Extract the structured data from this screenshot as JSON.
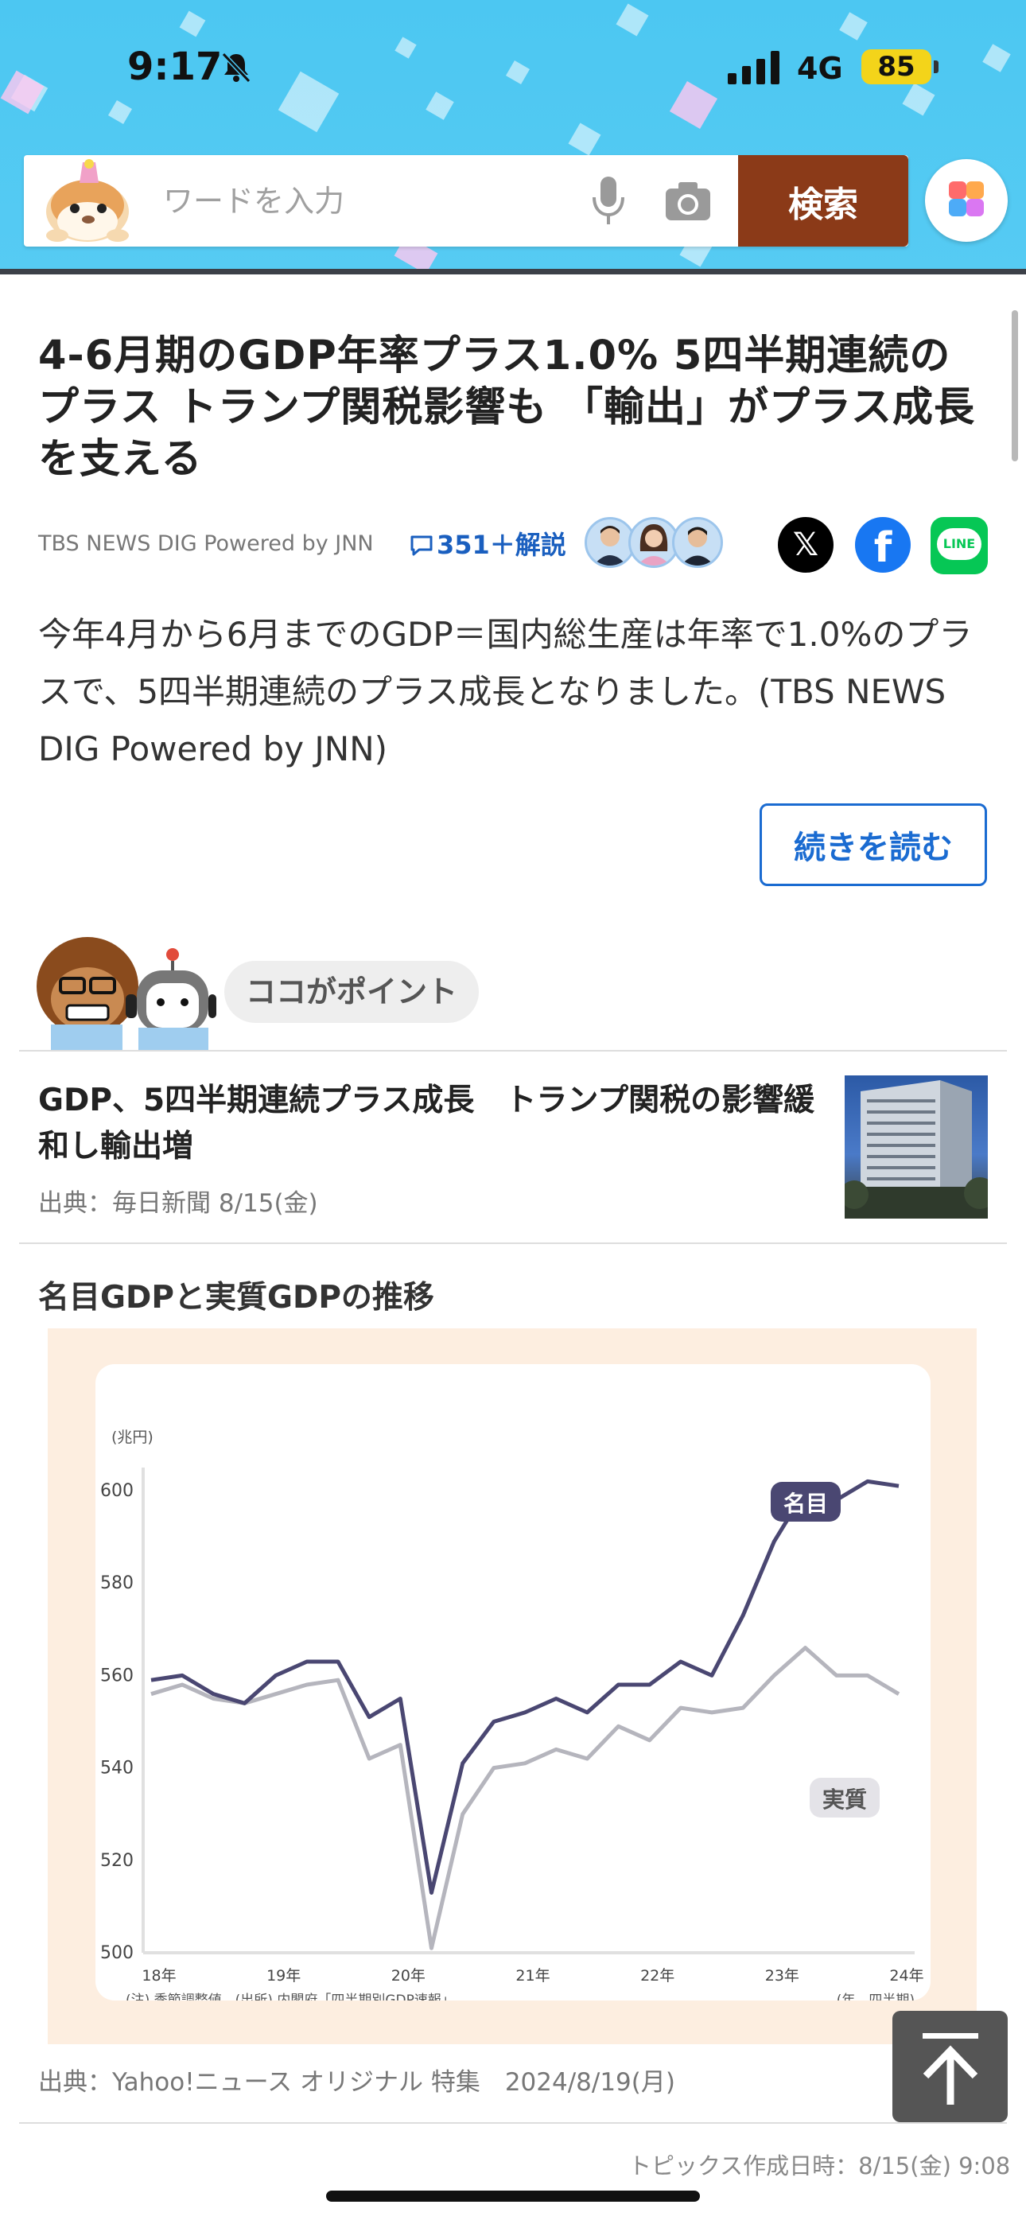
{
  "status_bar": {
    "time": "9:17",
    "network": "4G",
    "battery": "85"
  },
  "search": {
    "placeholder": "ワードを入力",
    "button_label": "検索"
  },
  "article": {
    "headline": "4-6月期のGDP年率プラス1.0% 5四半期連続のプラス トランプ関税影響も 「輸出」がプラス成長を支える",
    "source": "TBS NEWS DIG Powered by JNN",
    "comments": "351＋解説",
    "share": {
      "x": "𝕏",
      "facebook": "f",
      "line": "LINE"
    },
    "summary": "今年4月から6月までのGDP＝国内総生産は年率で1.0%のプラスで、5四半期連続のプラス成長となりました。(TBS NEWS DIG Powered by JNN)",
    "read_more": "続きを読む"
  },
  "point": {
    "label": "ココがポイント"
  },
  "related": {
    "title": "GDP、5四半期連続プラス成長　トランプ関税の影響緩和し輸出増",
    "source": "出典：毎日新聞 8/15(金)"
  },
  "chart_section": {
    "title": "名目GDPと実質GDPの推移",
    "source": "出典：Yahoo!ニュース オリジナル 特集　2024/8/19(月)"
  },
  "topic_date": "トピックス作成日時：8/15(金) 9:08",
  "colors": {
    "nominal": "#4a4772",
    "real": "#b5b5bd",
    "accent_link": "#1a6bd1",
    "search_button": "#8b3a18"
  },
  "chart_data": {
    "type": "line",
    "unit_label": "(兆円)",
    "ylim": [
      500,
      605
    ],
    "yticks": [
      500,
      520,
      540,
      560,
      580,
      600
    ],
    "xtick_labels": [
      "18年",
      "19年",
      "20年",
      "21年",
      "22年",
      "23年",
      "24年"
    ],
    "x_axis_note": "(年、四半期)",
    "footnote": "(注) 季節調整値　(出所) 内閣府「四半期別GDP速報」",
    "series": [
      {
        "name": "名目",
        "values": [
          559,
          560,
          556,
          554,
          560,
          563,
          563,
          551,
          555,
          513,
          541,
          550,
          552,
          555,
          552,
          558,
          558,
          563,
          560,
          573,
          589,
          600,
          598,
          602,
          601
        ]
      },
      {
        "name": "実質",
        "values": [
          556,
          558,
          555,
          554,
          556,
          558,
          559,
          542,
          545,
          501,
          530,
          540,
          541,
          544,
          542,
          549,
          546,
          553,
          552,
          553,
          560,
          566,
          560,
          560,
          556
        ]
      }
    ]
  }
}
